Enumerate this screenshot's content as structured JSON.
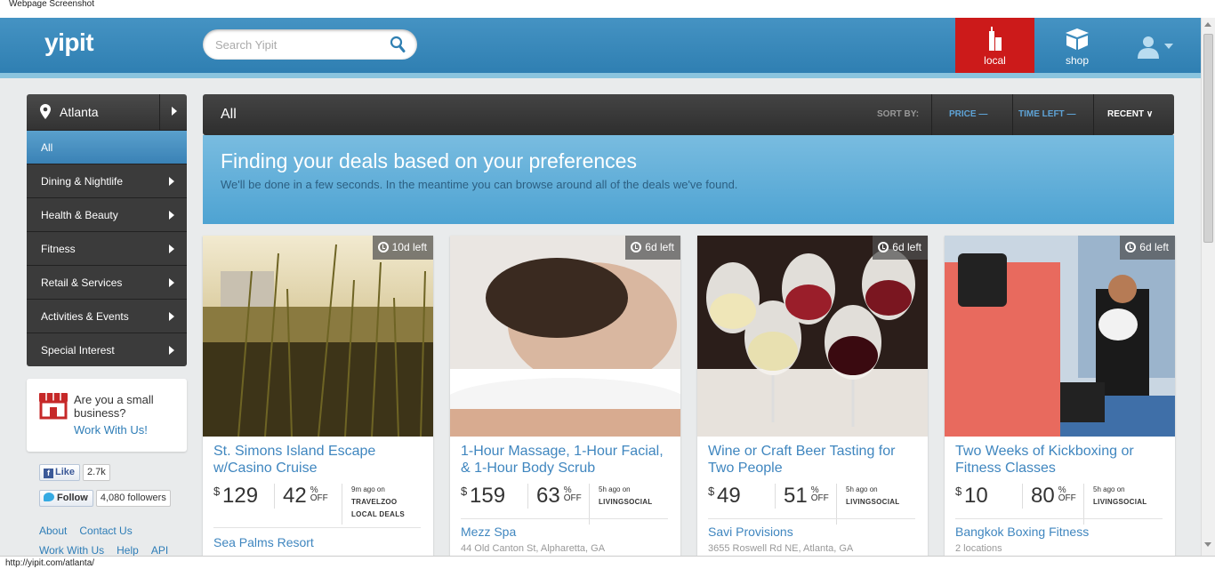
{
  "capture_label": "Webpage Screenshot",
  "header": {
    "logo": "yipit",
    "search_placeholder": "Search Yipit",
    "nav": {
      "local": "local",
      "shop": "shop"
    }
  },
  "sidebar": {
    "city": "Atlanta",
    "categories": [
      {
        "label": "All"
      },
      {
        "label": "Dining & Nightlife"
      },
      {
        "label": "Health & Beauty"
      },
      {
        "label": "Fitness"
      },
      {
        "label": "Retail & Services"
      },
      {
        "label": "Activities & Events"
      },
      {
        "label": "Special Interest"
      }
    ],
    "business": {
      "text": "Are you a small business?",
      "link": "Work With Us!"
    },
    "facebook": {
      "label": "Like",
      "count": "2.7k"
    },
    "twitter": {
      "label": "Follow",
      "count": "4,080 followers"
    },
    "footer_links": [
      "About",
      "Contact Us",
      "Work With Us",
      "Help",
      "API"
    ]
  },
  "main": {
    "bar_title": "All",
    "sort_label": "SORT BY:",
    "sort_options": {
      "price": "PRICE —",
      "time_left": "TIME LEFT —",
      "recent": "RECENT ∨"
    },
    "banner": {
      "title": "Finding your deals based on your preferences",
      "subtitle": "We'll be done in a few seconds. In the meantime you can browse around all of the deals we've found."
    },
    "deals": [
      {
        "time_left": "10d left",
        "title": "St. Simons Island Escape w/Casino Cruise",
        "currency": "$",
        "price": "129",
        "percent": "42",
        "pct_symbol": "%",
        "off": "OFF",
        "ago": "9m ago on",
        "source": "TRAVELZOO LOCAL DEALS",
        "merchant": "Sea Palms Resort",
        "address": ""
      },
      {
        "time_left": "6d left",
        "title": "1-Hour Massage, 1-Hour Facial, & 1-Hour Body Scrub",
        "currency": "$",
        "price": "159",
        "percent": "63",
        "pct_symbol": "%",
        "off": "OFF",
        "ago": "5h ago on",
        "source": "LIVINGSOCIAL",
        "merchant": "Mezz Spa",
        "address": "44 Old Canton St, Alpharetta, GA"
      },
      {
        "time_left": "6d left",
        "title": "Wine or Craft Beer Tasting for Two People",
        "currency": "$",
        "price": "49",
        "percent": "51",
        "pct_symbol": "%",
        "off": "OFF",
        "ago": "5h ago on",
        "source": "LIVINGSOCIAL",
        "merchant": "Savi Provisions",
        "address": "3655 Roswell Rd NE, Atlanta, GA"
      },
      {
        "time_left": "6d left",
        "title": "Two Weeks of Kickboxing or Fitness Classes",
        "currency": "$",
        "price": "10",
        "percent": "80",
        "pct_symbol": "%",
        "off": "OFF",
        "ago": "5h ago on",
        "source": "LIVINGSOCIAL",
        "merchant": "Bangkok Boxing Fitness",
        "address": "2 locations"
      }
    ]
  },
  "status_url": "http://yipit.com/atlanta/",
  "colors": {
    "header_blue": "#3a8abd",
    "local_red": "#cc1a1a",
    "link_blue": "#3f86bf",
    "banner_blue": "#62b0da"
  }
}
